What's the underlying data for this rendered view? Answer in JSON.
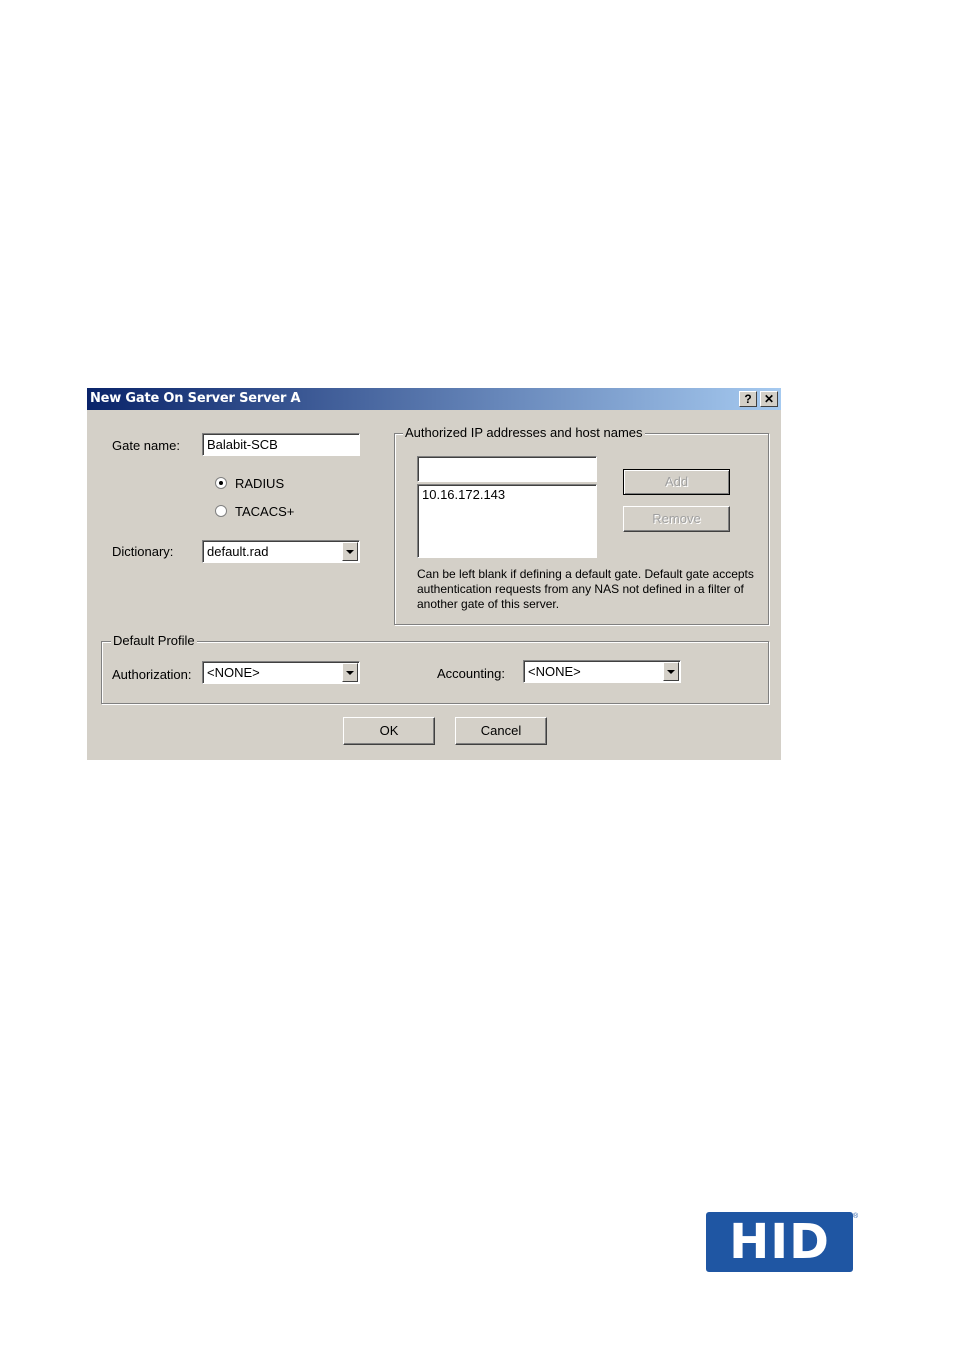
{
  "dialog": {
    "title": "New Gate On Server Server A",
    "help_button": "?",
    "close_button": "✕",
    "gate_name_label": "Gate name:",
    "gate_name_value": "Balabit-SCB",
    "protocol_options": [
      {
        "label": "RADIUS",
        "checked": true
      },
      {
        "label": "TACACS+",
        "checked": false
      }
    ],
    "dictionary_label": "Dictionary:",
    "dictionary_value": "default.rad",
    "authorized": {
      "group_title": "Authorized IP addresses and host names",
      "input_value": "",
      "list_items": [
        "10.16.172.143"
      ],
      "add_label": "Add",
      "remove_label": "Remove",
      "help_text": "Can be left blank if defining a default gate. Default gate accepts authentication requests from any NAS not defined in a filter of another gate of this server."
    },
    "default_profile": {
      "group_title": "Default Profile",
      "authorization_label": "Authorization:",
      "authorization_value": "<NONE>",
      "accounting_label": "Accounting:",
      "accounting_value": "<NONE>"
    },
    "ok_label": "OK",
    "cancel_label": "Cancel"
  },
  "logo": {
    "text": "HID",
    "registered_mark": "®",
    "color": "#1f56a3"
  }
}
